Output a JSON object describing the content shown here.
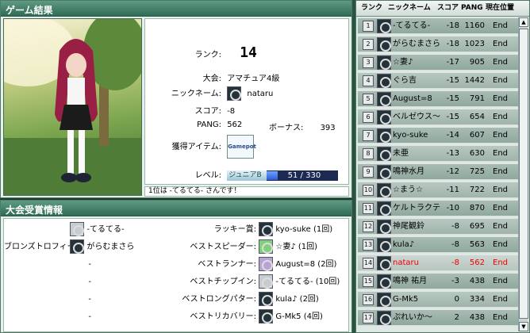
{
  "result": {
    "header": "ゲーム結果",
    "rank_label": "ランク:",
    "rank_value": "14",
    "contest_label": "大会:",
    "contest_value": "アマチュア4級",
    "nickname_label": "ニックネーム:",
    "nickname_value": "nataru",
    "score_label": "スコア:",
    "score_value": "-8",
    "pang_label": "PANG:",
    "pang_value": "562",
    "bonus_label": "ボーナス:",
    "bonus_value": "393",
    "item_label": "獲得アイテム:",
    "item_icon_text": "Gamepot",
    "level_label": "レベル:",
    "level_grade": "ジュニアB",
    "level_progress": "51 / 330",
    "level_fraction": 0.155,
    "footer": "1位は -てるてる- さんです！"
  },
  "awards": {
    "header": "大会受賞情報",
    "left": [
      {
        "title": "",
        "name": "-てるてる-",
        "icon": "avatar-icon"
      },
      {
        "title": "ブロンズトロフィー:",
        "name": "がらむまさら",
        "icon": "avatar-icon"
      },
      {
        "title": "-",
        "name": "",
        "icon": ""
      },
      {
        "title": "-",
        "name": "",
        "icon": ""
      },
      {
        "title": "-",
        "name": "",
        "icon": ""
      },
      {
        "title": "-",
        "name": "",
        "icon": ""
      }
    ],
    "right": [
      {
        "title": "ラッキー賞:",
        "name": "kyo-suke (1回)",
        "icon": "avatar-icon"
      },
      {
        "title": "ベストスピーダー:",
        "name": "☆妻♪ (1回)",
        "icon": "avatar-icon"
      },
      {
        "title": "ベストランナー:",
        "name": "August=8 (2回)",
        "icon": "avatar-icon"
      },
      {
        "title": "ベストチップイン:",
        "name": "-てるてる- (10回)",
        "icon": "avatar-icon"
      },
      {
        "title": "ベストロングパター:",
        "name": "kula♪ (2回)",
        "icon": "avatar-icon"
      },
      {
        "title": "ベストリカバリー:",
        "name": "G-Mk5 (4回)",
        "icon": "avatar-icon"
      }
    ]
  },
  "ranking": {
    "headers": {
      "rank": "ランク",
      "nickname": "ニックネーム",
      "score": "スコア",
      "pang": "PANG",
      "position": "現在位置"
    },
    "rows": [
      {
        "rank": "1",
        "name": "-てるてる-",
        "score": "-18",
        "pang": "1160",
        "pos": "End"
      },
      {
        "rank": "2",
        "name": "がらむまさら",
        "score": "-18",
        "pang": "1023",
        "pos": "End"
      },
      {
        "rank": "3",
        "name": "☆妻♪",
        "score": "-17",
        "pang": "905",
        "pos": "End"
      },
      {
        "rank": "4",
        "name": "ぐら吉",
        "score": "-15",
        "pang": "1442",
        "pos": "End"
      },
      {
        "rank": "5",
        "name": "August=8",
        "score": "-15",
        "pang": "791",
        "pos": "End"
      },
      {
        "rank": "6",
        "name": "ベルゼウス～",
        "score": "-15",
        "pang": "654",
        "pos": "End"
      },
      {
        "rank": "7",
        "name": "kyo-suke",
        "score": "-14",
        "pang": "607",
        "pos": "End"
      },
      {
        "rank": "8",
        "name": "未亜",
        "score": "-13",
        "pang": "630",
        "pos": "End"
      },
      {
        "rank": "9",
        "name": "鳴神水月",
        "score": "-12",
        "pang": "725",
        "pos": "End"
      },
      {
        "rank": "10",
        "name": "☆まう☆",
        "score": "-11",
        "pang": "722",
        "pos": "End"
      },
      {
        "rank": "11",
        "name": "ケルトラクテ",
        "score": "-10",
        "pang": "870",
        "pos": "End"
      },
      {
        "rank": "12",
        "name": "神尾観鈴",
        "score": "-8",
        "pang": "695",
        "pos": "End"
      },
      {
        "rank": "13",
        "name": "kula♪",
        "score": "-8",
        "pang": "563",
        "pos": "End"
      },
      {
        "rank": "14",
        "name": "nataru",
        "score": "-8",
        "pang": "562",
        "pos": "End"
      },
      {
        "rank": "15",
        "name": "鳴神 祐月",
        "score": "-3",
        "pang": "438",
        "pos": "End"
      },
      {
        "rank": "16",
        "name": "G-Mk5",
        "score": "0",
        "pang": "334",
        "pos": "End"
      },
      {
        "rank": "17",
        "name": "ぷれいか～",
        "score": "2",
        "pang": "438",
        "pos": "End"
      }
    ],
    "highlight_rank": "14"
  },
  "colors": {
    "accent_header": "#2f6b55",
    "highlight_text": "#ee0000",
    "level_fill": "#2f5bd8"
  }
}
